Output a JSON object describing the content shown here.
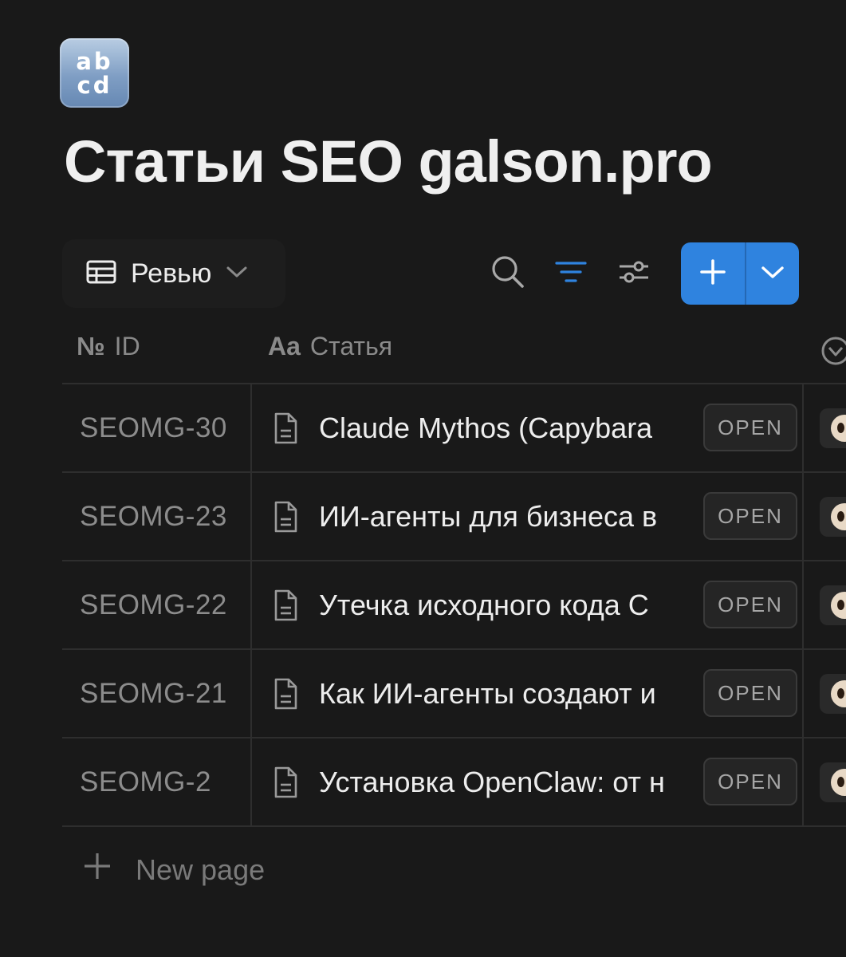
{
  "page": {
    "icon_lines": [
      "ab",
      "cd"
    ],
    "title": "Статьи SEO galson.pro"
  },
  "toolbar": {
    "view_label": "Ревью",
    "view_icon": "table-icon",
    "search_icon": "search-icon",
    "filter_icon": "filter-icon",
    "settings_icon": "sliders-icon",
    "new_icon": "plus-icon",
    "accent_color": "#2f83df"
  },
  "table": {
    "columns": [
      {
        "icon": "№",
        "label": "ID"
      },
      {
        "icon": "Aa",
        "label": "Статья"
      }
    ],
    "open_label": "OPEN",
    "rows": [
      {
        "id": "SEOMG-30",
        "title": "Claude Mythos (Capybara"
      },
      {
        "id": "SEOMG-23",
        "title": "ИИ-агенты для бизнеса в"
      },
      {
        "id": "SEOMG-22",
        "title": "Утечка исходного кода C"
      },
      {
        "id": "SEOMG-21",
        "title": "Как ИИ-агенты создают и"
      },
      {
        "id": "SEOMG-2",
        "title": "Установка OpenClaw: от н"
      }
    ]
  },
  "footer": {
    "new_page_label": "New page"
  }
}
